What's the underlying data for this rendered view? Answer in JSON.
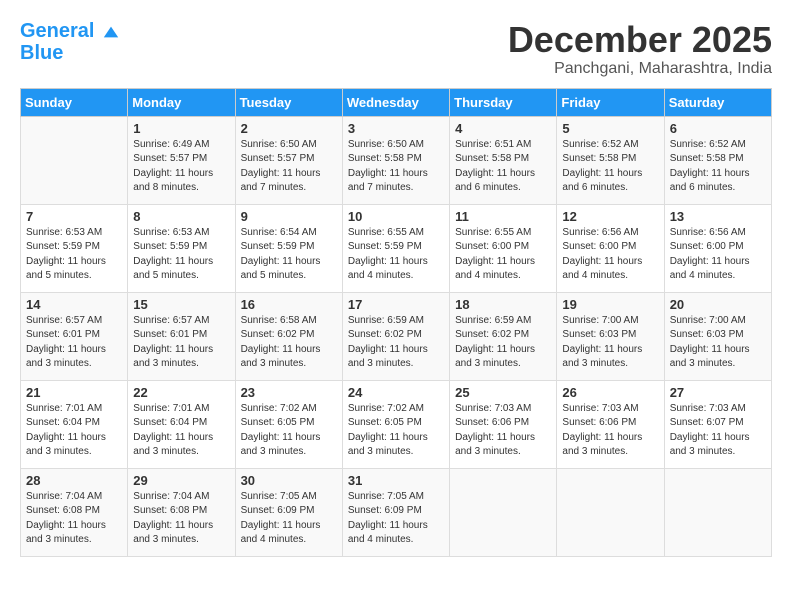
{
  "logo": {
    "line1": "General",
    "line2": "Blue"
  },
  "title": "December 2025",
  "location": "Panchgani, Maharashtra, India",
  "days_header": [
    "Sunday",
    "Monday",
    "Tuesday",
    "Wednesday",
    "Thursday",
    "Friday",
    "Saturday"
  ],
  "weeks": [
    [
      {
        "day": "",
        "sunrise": "",
        "sunset": "",
        "daylight": ""
      },
      {
        "day": "1",
        "sunrise": "6:49 AM",
        "sunset": "5:57 PM",
        "daylight": "11 hours and 8 minutes."
      },
      {
        "day": "2",
        "sunrise": "6:50 AM",
        "sunset": "5:57 PM",
        "daylight": "11 hours and 7 minutes."
      },
      {
        "day": "3",
        "sunrise": "6:50 AM",
        "sunset": "5:58 PM",
        "daylight": "11 hours and 7 minutes."
      },
      {
        "day": "4",
        "sunrise": "6:51 AM",
        "sunset": "5:58 PM",
        "daylight": "11 hours and 6 minutes."
      },
      {
        "day": "5",
        "sunrise": "6:52 AM",
        "sunset": "5:58 PM",
        "daylight": "11 hours and 6 minutes."
      },
      {
        "day": "6",
        "sunrise": "6:52 AM",
        "sunset": "5:58 PM",
        "daylight": "11 hours and 6 minutes."
      }
    ],
    [
      {
        "day": "7",
        "sunrise": "6:53 AM",
        "sunset": "5:59 PM",
        "daylight": "11 hours and 5 minutes."
      },
      {
        "day": "8",
        "sunrise": "6:53 AM",
        "sunset": "5:59 PM",
        "daylight": "11 hours and 5 minutes."
      },
      {
        "day": "9",
        "sunrise": "6:54 AM",
        "sunset": "5:59 PM",
        "daylight": "11 hours and 5 minutes."
      },
      {
        "day": "10",
        "sunrise": "6:55 AM",
        "sunset": "5:59 PM",
        "daylight": "11 hours and 4 minutes."
      },
      {
        "day": "11",
        "sunrise": "6:55 AM",
        "sunset": "6:00 PM",
        "daylight": "11 hours and 4 minutes."
      },
      {
        "day": "12",
        "sunrise": "6:56 AM",
        "sunset": "6:00 PM",
        "daylight": "11 hours and 4 minutes."
      },
      {
        "day": "13",
        "sunrise": "6:56 AM",
        "sunset": "6:00 PM",
        "daylight": "11 hours and 4 minutes."
      }
    ],
    [
      {
        "day": "14",
        "sunrise": "6:57 AM",
        "sunset": "6:01 PM",
        "daylight": "11 hours and 3 minutes."
      },
      {
        "day": "15",
        "sunrise": "6:57 AM",
        "sunset": "6:01 PM",
        "daylight": "11 hours and 3 minutes."
      },
      {
        "day": "16",
        "sunrise": "6:58 AM",
        "sunset": "6:02 PM",
        "daylight": "11 hours and 3 minutes."
      },
      {
        "day": "17",
        "sunrise": "6:59 AM",
        "sunset": "6:02 PM",
        "daylight": "11 hours and 3 minutes."
      },
      {
        "day": "18",
        "sunrise": "6:59 AM",
        "sunset": "6:02 PM",
        "daylight": "11 hours and 3 minutes."
      },
      {
        "day": "19",
        "sunrise": "7:00 AM",
        "sunset": "6:03 PM",
        "daylight": "11 hours and 3 minutes."
      },
      {
        "day": "20",
        "sunrise": "7:00 AM",
        "sunset": "6:03 PM",
        "daylight": "11 hours and 3 minutes."
      }
    ],
    [
      {
        "day": "21",
        "sunrise": "7:01 AM",
        "sunset": "6:04 PM",
        "daylight": "11 hours and 3 minutes."
      },
      {
        "day": "22",
        "sunrise": "7:01 AM",
        "sunset": "6:04 PM",
        "daylight": "11 hours and 3 minutes."
      },
      {
        "day": "23",
        "sunrise": "7:02 AM",
        "sunset": "6:05 PM",
        "daylight": "11 hours and 3 minutes."
      },
      {
        "day": "24",
        "sunrise": "7:02 AM",
        "sunset": "6:05 PM",
        "daylight": "11 hours and 3 minutes."
      },
      {
        "day": "25",
        "sunrise": "7:03 AM",
        "sunset": "6:06 PM",
        "daylight": "11 hours and 3 minutes."
      },
      {
        "day": "26",
        "sunrise": "7:03 AM",
        "sunset": "6:06 PM",
        "daylight": "11 hours and 3 minutes."
      },
      {
        "day": "27",
        "sunrise": "7:03 AM",
        "sunset": "6:07 PM",
        "daylight": "11 hours and 3 minutes."
      }
    ],
    [
      {
        "day": "28",
        "sunrise": "7:04 AM",
        "sunset": "6:08 PM",
        "daylight": "11 hours and 3 minutes."
      },
      {
        "day": "29",
        "sunrise": "7:04 AM",
        "sunset": "6:08 PM",
        "daylight": "11 hours and 3 minutes."
      },
      {
        "day": "30",
        "sunrise": "7:05 AM",
        "sunset": "6:09 PM",
        "daylight": "11 hours and 4 minutes."
      },
      {
        "day": "31",
        "sunrise": "7:05 AM",
        "sunset": "6:09 PM",
        "daylight": "11 hours and 4 minutes."
      },
      {
        "day": "",
        "sunrise": "",
        "sunset": "",
        "daylight": ""
      },
      {
        "day": "",
        "sunrise": "",
        "sunset": "",
        "daylight": ""
      },
      {
        "day": "",
        "sunrise": "",
        "sunset": "",
        "daylight": ""
      }
    ]
  ],
  "labels": {
    "sunrise_prefix": "Sunrise: ",
    "sunset_prefix": "Sunset: ",
    "daylight_prefix": "Daylight: "
  }
}
